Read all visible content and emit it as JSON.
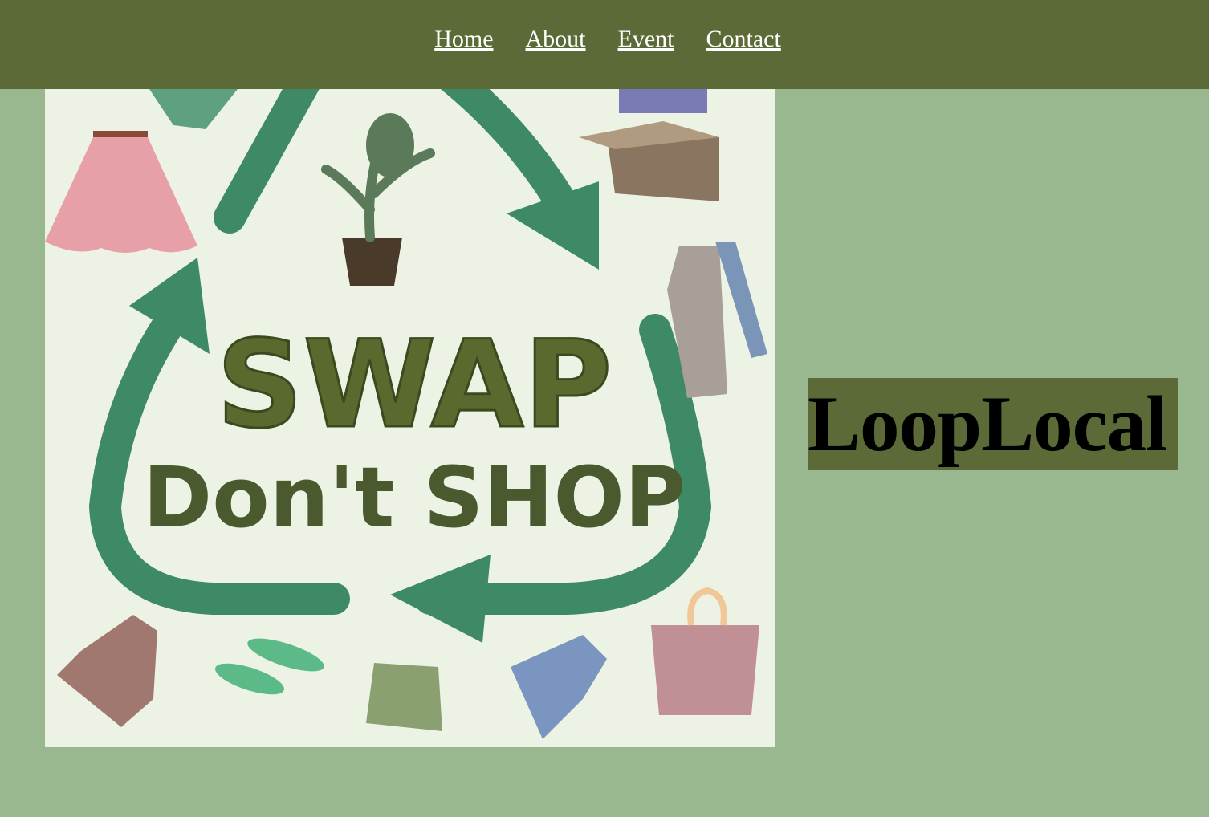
{
  "nav": {
    "items": [
      {
        "label": "Home"
      },
      {
        "label": "About"
      },
      {
        "label": "Event"
      },
      {
        "label": "Contact"
      }
    ]
  },
  "hero": {
    "line1": "SWAP",
    "line2": "Don't SHOP"
  },
  "brand": {
    "title": "LoopLocal"
  },
  "colors": {
    "nav_bg": "#5b6a36",
    "page_bg": "#9ab890",
    "arrow_green": "#3f8a66",
    "text_olive": "#4a5a2e"
  }
}
